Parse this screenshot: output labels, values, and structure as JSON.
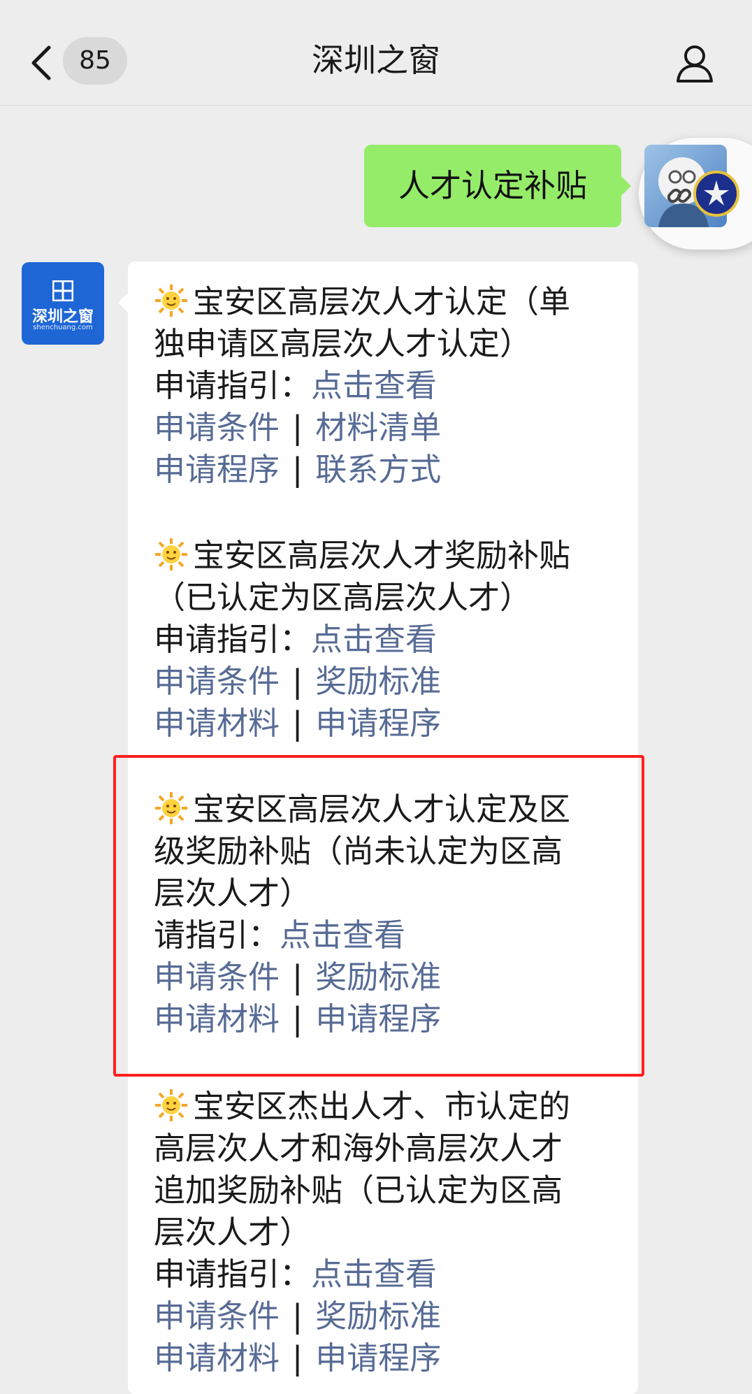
{
  "header": {
    "unread_count": "85",
    "title": "深圳之窗"
  },
  "outgoing": {
    "text": "人才认定补贴"
  },
  "account_avatar": {
    "name": "深圳之窗",
    "domain": "shenchuang.com"
  },
  "sections": [
    {
      "title_lines": [
        "宝安区高层次人才认定（单",
        "独申请区高层次人才认定）"
      ],
      "guide_label": "申请指引：",
      "guide_link": "点击查看",
      "row1": [
        "申请条件",
        "材料清单"
      ],
      "row2": [
        "申请程序",
        "联系方式"
      ]
    },
    {
      "title_lines": [
        "宝安区高层次人才奖励补贴",
        "（已认定为区高层次人才）"
      ],
      "guide_label": "申请指引：",
      "guide_link": "点击查看",
      "row1": [
        "申请条件",
        "奖励标准"
      ],
      "row2": [
        "申请材料",
        "申请程序"
      ]
    },
    {
      "title_lines": [
        "宝安区高层次人才认定及区",
        "级奖励补贴（尚未认定为区高",
        "层次人才）"
      ],
      "guide_label": "请指引：",
      "guide_link": "点击查看",
      "row1": [
        "申请条件",
        "奖励标准"
      ],
      "row2": [
        "申请材料",
        "申请程序"
      ]
    },
    {
      "title_lines": [
        "宝安区杰出人才、市认定的",
        "高层次人才和海外高层次人才",
        "追加奖励补贴（已认定为区高",
        "层次人才）"
      ],
      "guide_label": "申请指引：",
      "guide_link": "点击查看",
      "row1": [
        "申请条件",
        "奖励标准"
      ],
      "row2": [
        "申请材料",
        "申请程序"
      ]
    }
  ],
  "separator": "|",
  "colors": {
    "background": "#ededed",
    "outgoing_bubble": "#95ec69",
    "link": "#576b95",
    "highlight_border": "#ff1f1f"
  }
}
